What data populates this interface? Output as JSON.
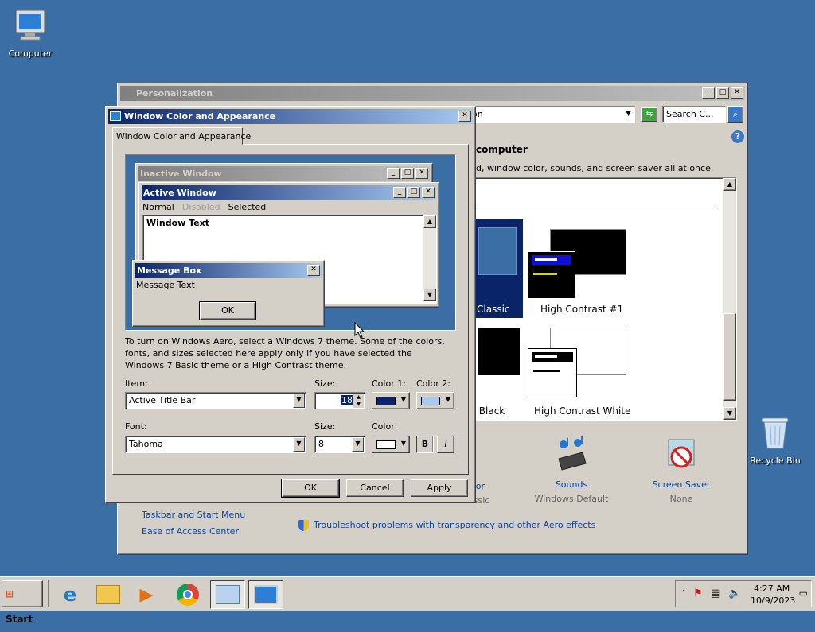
{
  "desktop": {
    "computer_label": "Computer",
    "recycle_label": "Recycle Bin"
  },
  "personalization": {
    "title": "Personalization",
    "address_partial": "on",
    "search_placeholder": "Search C...",
    "heading_partial": "computer",
    "desc_partial": "d, window color, sounds, and screen saver all at once.",
    "themes": [
      {
        "label": "Classic"
      },
      {
        "label": "High Contrast #1"
      },
      {
        "label": "st Black"
      },
      {
        "label": "High Contrast White"
      }
    ],
    "bottom_items": [
      {
        "label": "olor",
        "sub": "assic"
      },
      {
        "label": "Sounds",
        "sub": "Windows Default"
      },
      {
        "label": "Screen Saver",
        "sub": "None"
      }
    ],
    "see_also": [
      "Taskbar and Start Menu",
      "Ease of Access Center"
    ],
    "troubleshoot_link": "Troubleshoot problems with transparency and other Aero effects"
  },
  "dialog": {
    "title": "Window Color and Appearance",
    "tab": "Window Color and Appearance",
    "preview": {
      "inactive_title": "Inactive Window",
      "active_title": "Active Window",
      "menu": [
        "Normal",
        "Disabled",
        "Selected"
      ],
      "window_text": "Window Text",
      "msgbox_title": "Message Box",
      "msgbox_text": "Message Text",
      "msgbox_ok": "OK"
    },
    "info_text": "To turn on Windows Aero, select a Windows 7 theme.  Some of the colors, fonts, and sizes selected here apply only if you have selected the Windows 7 Basic theme or a High Contrast theme.",
    "item_label": "Item:",
    "item_value": "Active Title Bar",
    "size_label": "Size:",
    "size_value": "18",
    "color1_label": "Color 1:",
    "color2_label": "Color 2:",
    "color1": "#0a246a",
    "color2": "#a6caf0",
    "font_label": "Font:",
    "font_value": "Tahoma",
    "font_size_label": "Size:",
    "font_size_value": "8",
    "font_color_label": "Color:",
    "font_color": "#ffffff",
    "bold_label": "B",
    "italic_label": "I",
    "ok": "OK",
    "cancel": "Cancel",
    "apply": "Apply"
  },
  "taskbar": {
    "start_label": "Start",
    "time": "4:27 AM",
    "date": "10/9/2023"
  }
}
